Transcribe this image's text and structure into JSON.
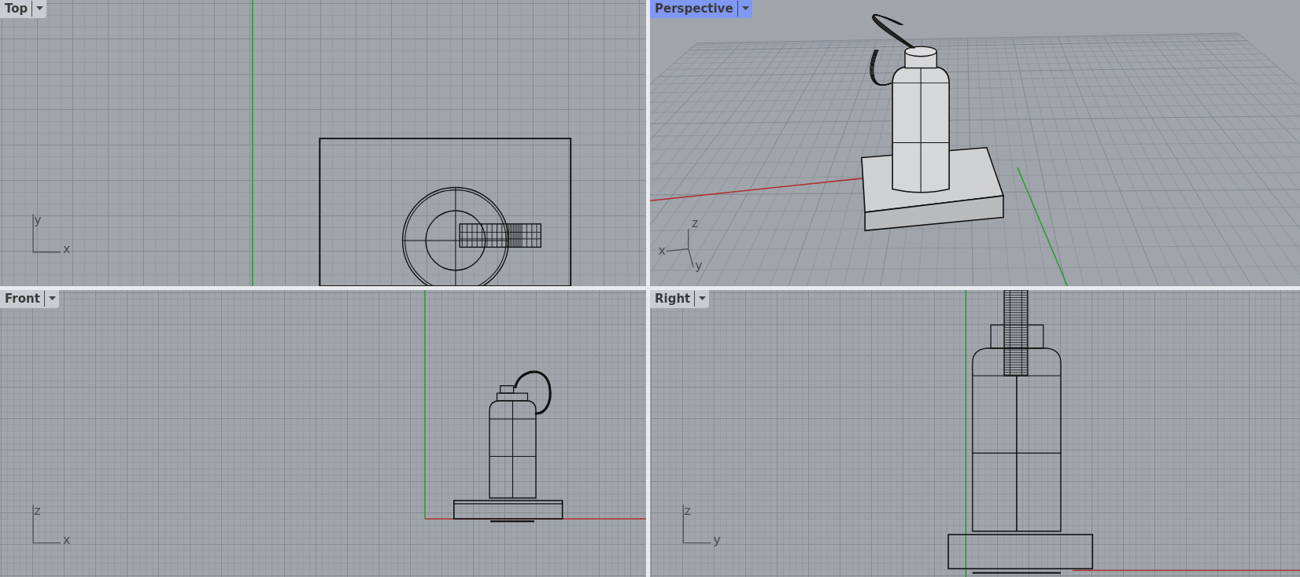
{
  "viewports": [
    {
      "title": "Top",
      "kind": "top",
      "selected": false,
      "axis_labels": [
        "y",
        "x"
      ]
    },
    {
      "title": "Perspective",
      "kind": "perspective",
      "selected": true,
      "axis_labels": [
        "z",
        "x",
        "y"
      ]
    },
    {
      "title": "Front",
      "kind": "front",
      "selected": false,
      "axis_labels": [
        "z",
        "x"
      ]
    },
    {
      "title": "Right",
      "kind": "right",
      "selected": false,
      "axis_labels": [
        "z",
        "y"
      ]
    }
  ]
}
